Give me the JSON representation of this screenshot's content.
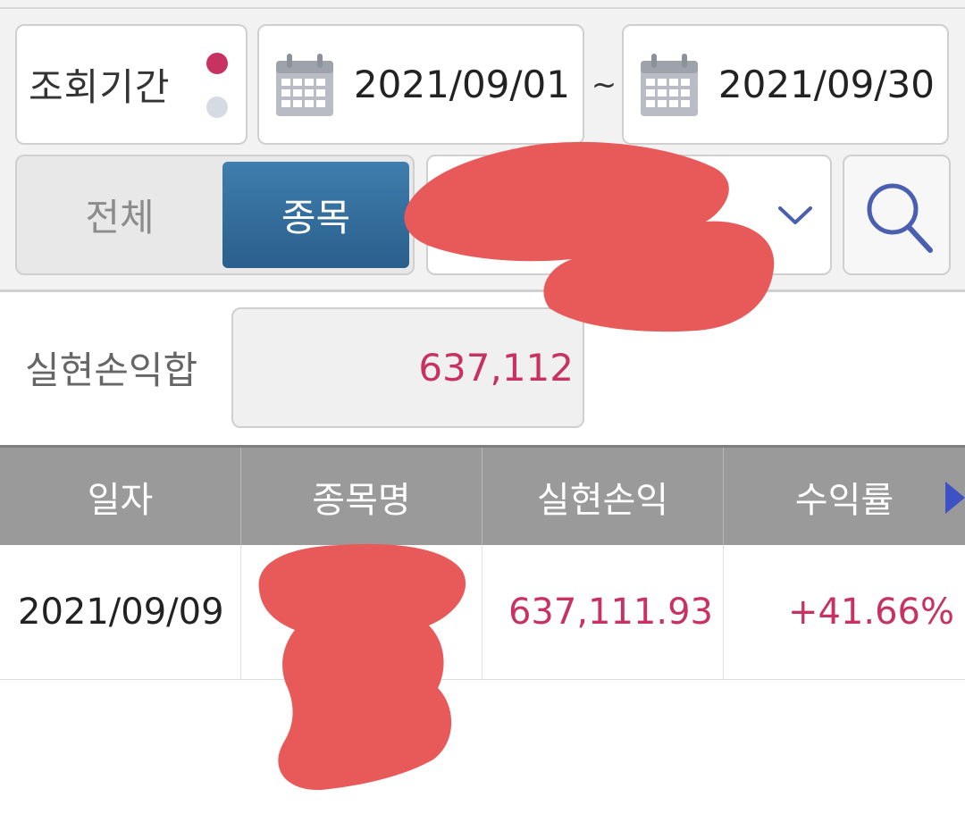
{
  "query": {
    "period_label": "조회기간",
    "start_date": "2021/09/01",
    "separator": "~",
    "end_date": "2021/09/30",
    "icons": {
      "calendar": "calendar-icon",
      "chevron": "chevron-down-icon",
      "search": "search-icon"
    }
  },
  "filter": {
    "all_label": "전체",
    "stock_label": "종목",
    "selected": "종목",
    "stock_select_value": ""
  },
  "summary": {
    "label": "실현손익합",
    "value": "637,112"
  },
  "table": {
    "headers": [
      "일자",
      "종목명",
      "실현손익",
      "수익률"
    ],
    "rows": [
      {
        "date": "2021/09/09",
        "name": "",
        "realized_pnl": "637,111.93",
        "return_rate": "+41.66%"
      }
    ]
  },
  "colors": {
    "accent": "#c83262",
    "button_blue": "#2f6a9a",
    "header_gray": "#9a9a9a",
    "icon_blue": "#4a5fb0",
    "redaction": "#e85a5a"
  }
}
